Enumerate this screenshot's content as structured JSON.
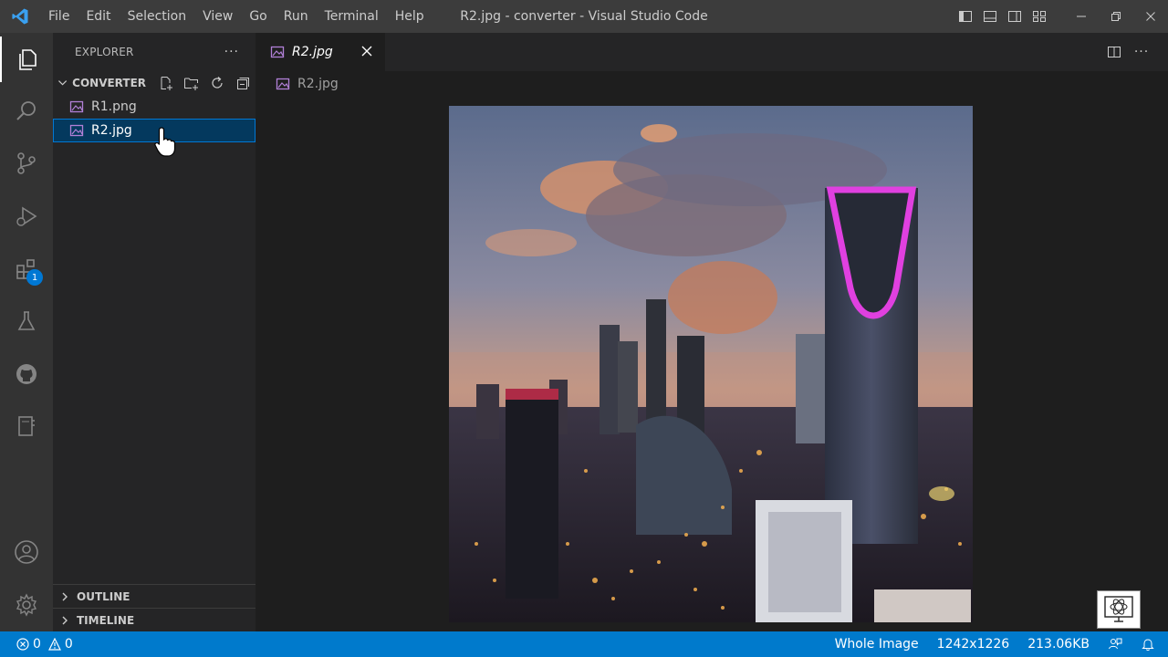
{
  "window": {
    "title": "R2.jpg - converter - Visual Studio Code",
    "menu": [
      "File",
      "Edit",
      "Selection",
      "View",
      "Go",
      "Run",
      "Terminal",
      "Help"
    ]
  },
  "activity_bar": {
    "items": [
      "explorer-icon",
      "search-icon",
      "source-control-icon",
      "run-debug-icon",
      "extensions-icon",
      "testing-icon",
      "github-icon",
      "notebook-icon"
    ],
    "extensions_badge": "1",
    "bottom_items": [
      "account-icon",
      "settings-gear-icon"
    ]
  },
  "sidebar": {
    "title": "EXPLORER",
    "more": "···",
    "folder": "CONVERTER",
    "files": [
      {
        "name": "R1.png",
        "selected": false
      },
      {
        "name": "R2.jpg",
        "selected": true
      }
    ],
    "sections": [
      "OUTLINE",
      "TIMELINE"
    ]
  },
  "editor": {
    "tab_label": "R2.jpg",
    "breadcrumb": "R2.jpg",
    "more": "···",
    "image_description_alt": "R2.jpg"
  },
  "statusbar": {
    "errors": "0",
    "warnings": "0",
    "zoom": "Whole Image",
    "dimensions": "1242x1226",
    "size": "213.06KB"
  },
  "colors": {
    "accent": "#007acc",
    "selection": "#04395e",
    "titlebar": "#3c3c3c",
    "activitybar": "#333333",
    "sidebar": "#252526",
    "editor": "#1e1e1e",
    "image_icon": "#b180d7"
  }
}
